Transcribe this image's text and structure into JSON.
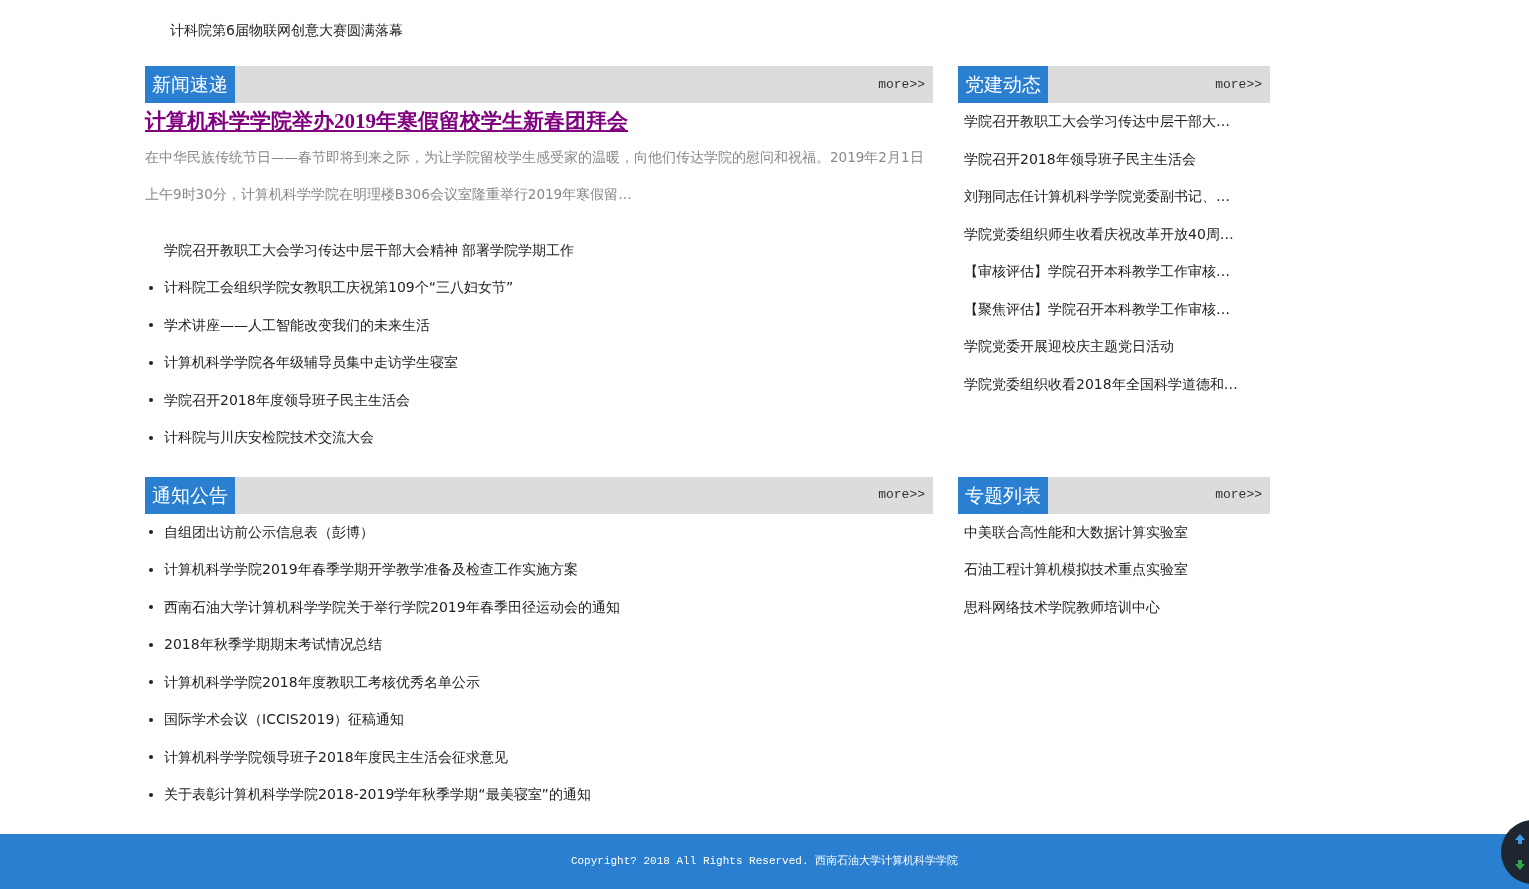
{
  "top_strip": {
    "left_item": "计科院第6届物联网创意大赛圆满落幕"
  },
  "news": {
    "title": "新闻速递",
    "more": "more>>",
    "headline": "计算机科学学院举办2019年寒假留校学生新春团拜会",
    "summary": "在中华民族传统节日——春节即将到来之际，为让学院留校学生感受家的温暖，向他们传达学院的慰问和祝福。2019年2月1日上午9时30分，计算机科学学院在明理楼B306会议室隆重举行2019年寒假留…",
    "items": [
      {
        "text": "学院召开教职工大会学习传达中层干部大会精神 部署学院学期工作",
        "bullet": false
      },
      {
        "text": "计科院工会组织学院女教职工庆祝第109个“三八妇女节”",
        "bullet": true
      },
      {
        "text": "学术讲座——人工智能改变我们的未来生活",
        "bullet": true
      },
      {
        "text": "计算机科学学院各年级辅导员集中走访学生寝室",
        "bullet": true
      },
      {
        "text": "学院召开2018年度领导班子民主生活会",
        "bullet": true
      },
      {
        "text": "计科院与川庆安检院技术交流大会",
        "bullet": true
      }
    ]
  },
  "party": {
    "title": "党建动态",
    "more": "more>>",
    "items": [
      "学院召开教职工大会学习传达中层干部大…",
      "学院召开2018年领导班子民主生活会",
      "刘翔同志任计算机科学学院党委副书记、…",
      "学院党委组织师生收看庆祝改革开放40周…",
      "【审核评估】学院召开本科教学工作审核…",
      "【聚焦评估】学院召开本科教学工作审核…",
      "学院党委开展迎校庆主题党日活动",
      "学院党委组织收看2018年全国科学道德和…"
    ]
  },
  "notices": {
    "title": "通知公告",
    "more": "more>>",
    "items": [
      {
        "text": "自组团出访前公示信息表（彭博）",
        "bullet": true
      },
      {
        "text": "计算机科学学院2019年春季学期开学教学准备及检查工作实施方案",
        "bullet": true
      },
      {
        "text": "西南石油大学计算机科学学院关于举行学院2019年春季田径运动会的通知",
        "bullet": true
      },
      {
        "text": "2018年秋季学期期末考试情况总结",
        "bullet": true
      },
      {
        "text": "计算机科学学院2018年度教职工考核优秀名单公示",
        "bullet": true
      },
      {
        "text": "国际学术会议（ICCIS2019）征稿通知",
        "bullet": true
      },
      {
        "text": "计算机科学学院领导班子2018年度民主生活会征求意见",
        "bullet": true
      },
      {
        "text": "关于表彰计算机科学学院2018-2019学年秋季学期“最美寝室”的通知",
        "bullet": true
      }
    ]
  },
  "topics": {
    "title": "专题列表",
    "more": "more>>",
    "items": [
      "中美联合高性能和大数据计算实验室",
      "石油工程计算机模拟技术重点实验室",
      "思科网络技术学院教师培训中心"
    ]
  },
  "footer": {
    "copyright": "Copyright? 2018 All Rights Reserved. 西南石油大学计算机科学学院"
  }
}
